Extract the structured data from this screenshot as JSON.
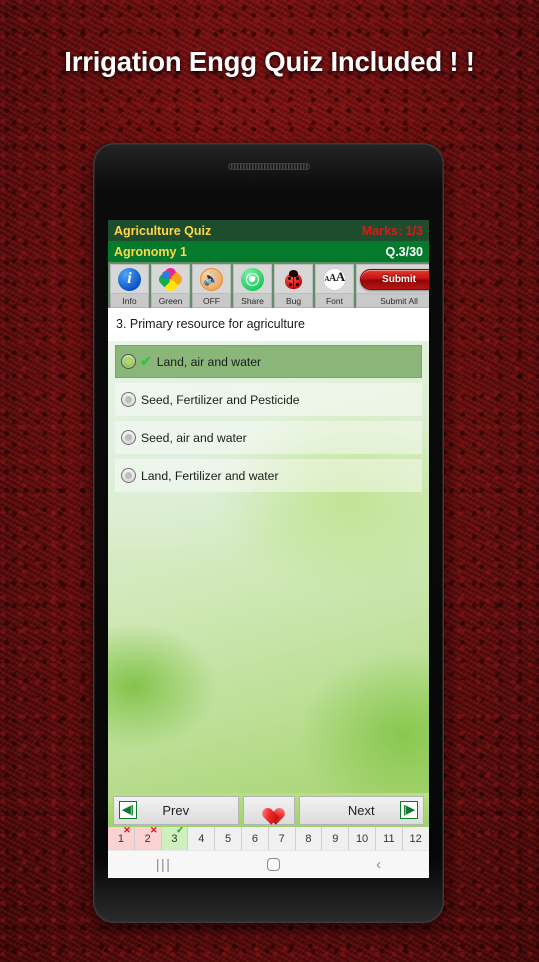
{
  "headline": "Irrigation Engg Quiz Included ! !",
  "app": {
    "title": "Agriculture Quiz",
    "marks": "Marks: 1/3",
    "subject": "Agronomy 1",
    "question_counter": "Q.3/30"
  },
  "toolbar": [
    {
      "label": "Info",
      "icon": "info-icon"
    },
    {
      "label": "Green",
      "icon": "pinwheel-icon"
    },
    {
      "label": "OFF",
      "icon": "speaker-icon"
    },
    {
      "label": "Share",
      "icon": "whatsapp-icon"
    },
    {
      "label": "Bug",
      "icon": "ladybug-icon"
    },
    {
      "label": "Font",
      "icon": "font-size-icon"
    },
    {
      "label": "Submit All",
      "icon": "submit-button",
      "button_text": "Submit"
    }
  ],
  "question": {
    "text": "3. Primary resource for agriculture",
    "options": [
      {
        "label": "Land, air and water",
        "selected": true,
        "tick": "✔"
      },
      {
        "label": "Seed, Fertilizer and Pesticide",
        "selected": false,
        "tick": ""
      },
      {
        "label": "Seed, air and water",
        "selected": false,
        "tick": ""
      },
      {
        "label": "Land, Fertilizer and water",
        "selected": false,
        "tick": ""
      }
    ]
  },
  "nav": {
    "prev_label": "Prev",
    "next_label": "Next",
    "prev_icon_glyph": "⏮",
    "next_icon_glyph": "⏭",
    "favorite_icon": "heart-icon"
  },
  "number_strip": [
    {
      "number": "1",
      "state": "wrong",
      "mark": "✕"
    },
    {
      "number": "2",
      "state": "wrong",
      "mark": "✕"
    },
    {
      "number": "3",
      "state": "right",
      "mark": "✓"
    },
    {
      "number": "4",
      "state": "none",
      "mark": ""
    },
    {
      "number": "5",
      "state": "none",
      "mark": ""
    },
    {
      "number": "6",
      "state": "none",
      "mark": ""
    },
    {
      "number": "7",
      "state": "none",
      "mark": ""
    },
    {
      "number": "8",
      "state": "none",
      "mark": ""
    },
    {
      "number": "9",
      "state": "none",
      "mark": ""
    },
    {
      "number": "10",
      "state": "none",
      "mark": ""
    },
    {
      "number": "11",
      "state": "none",
      "mark": ""
    },
    {
      "number": "12",
      "state": "none",
      "mark": ""
    }
  ],
  "android_nav": {
    "recents": "|||",
    "home": "home-icon",
    "back": "‹"
  },
  "colors": {
    "backdrop_red": "#6d0d0d",
    "titlebar_dark_green": "#1d4d2d",
    "titlebar_green": "#057a2d",
    "title_yellow": "#ffd64a",
    "marks_red": "#e01717",
    "toolbar_green": "#5e8f66",
    "submit_red": "#c41010",
    "selected_option_green": "#8ab679",
    "tick_green": "#28c93f",
    "wrong_cell": "#fbd2d2",
    "right_cell": "#cdf0bc"
  }
}
